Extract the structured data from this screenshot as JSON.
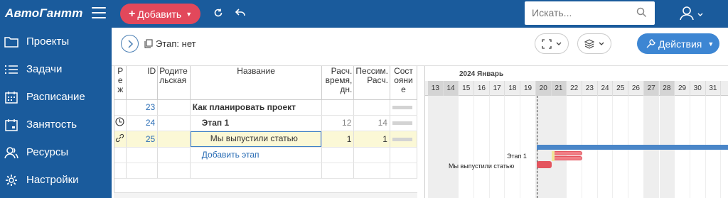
{
  "header": {
    "logo": "АвтоГантт",
    "add_label": "Добавить",
    "search_placeholder": "Искать...",
    "brand_color": "#1a5b9c",
    "add_color": "#e2485b",
    "icons": [
      "menu-icon",
      "refresh-icon",
      "undo-icon",
      "search-icon",
      "user-icon",
      "chevron-down-icon"
    ]
  },
  "sidebar": {
    "items": [
      {
        "label": "Проекты",
        "icon": "folder-icon"
      },
      {
        "label": "Задачи",
        "icon": "list-icon"
      },
      {
        "label": "Расписание",
        "icon": "calendar-icon"
      },
      {
        "label": "Занятость",
        "icon": "occupancy-icon"
      },
      {
        "label": "Ресурсы",
        "icon": "users-icon"
      },
      {
        "label": "Настройки",
        "icon": "gear-icon"
      }
    ]
  },
  "toolbar": {
    "stage_label": "Этап: нет",
    "actions_label": "Действия",
    "actions_color": "#3d86d3"
  },
  "table": {
    "columns": {
      "mode": "Реж",
      "id": "ID",
      "parent": "Родительская",
      "name": "Название",
      "calc_time": "Расч. время, дн.",
      "pess": "Пессим. Расч.",
      "state": "Состояние"
    },
    "rows": [
      {
        "id": "23",
        "name": "Как планировать проект",
        "calc": "",
        "pess": ""
      },
      {
        "id": "24",
        "name": "Этап 1",
        "calc": "12",
        "pess": "14"
      },
      {
        "id": "25",
        "name": "Мы выпустили статью",
        "calc": "1",
        "pess": "1"
      }
    ],
    "add_stage": "Добавить этап"
  },
  "gantt": {
    "month_label": "2024 Январь",
    "days": [
      "13",
      "14",
      "15",
      "16",
      "17",
      "18",
      "19",
      "20",
      "21",
      "22",
      "23",
      "24",
      "25",
      "26",
      "27",
      "28",
      "29",
      "30",
      "31"
    ],
    "weekend_days": [
      "13",
      "14",
      "20",
      "21",
      "27",
      "28"
    ],
    "bar_labels": {
      "stage": "Этап 1",
      "task": "Мы выпустили статью"
    },
    "colors": {
      "summary_bar": "#4a86c8",
      "task_bar": "#e4545e",
      "weekend": "#d4d4d4"
    }
  }
}
